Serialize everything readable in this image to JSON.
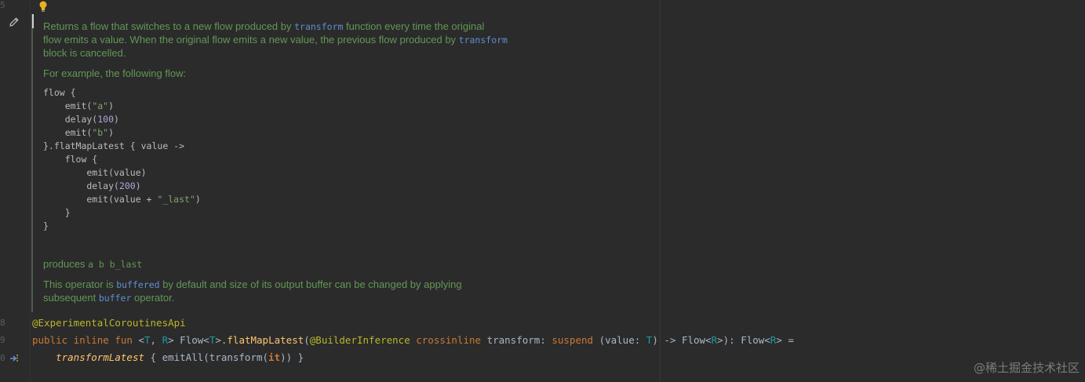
{
  "editor": {
    "gutter_numbers": [
      "5",
      "8",
      "9",
      "0"
    ],
    "doc": {
      "para1_line1_a": "Returns a flow that switches to a new flow produced by ",
      "para1_line1_code": "transform",
      "para1_line1_b": " function every time the original",
      "para1_line2_a": "flow emits a value. When the original flow emits a new value, the previous flow produced by ",
      "para1_line2_code": "transform",
      "para1_line3": "block is cancelled.",
      "para2": "For example, the following flow:",
      "code_lines": [
        "flow {",
        "    emit(\"a\")",
        "    delay(100)",
        "    emit(\"b\")",
        "}.flatMapLatest { value ->",
        "    flow {",
        "        emit(value)",
        "        delay(200)",
        "        emit(value + \"_last\")",
        "    }",
        "}"
      ],
      "produces_label": "produces ",
      "produces_code": "a b b_last",
      "para4_line1_a": "This operator is ",
      "para4_line1_code": "buffered",
      "para4_line1_b": " by default and size of its output buffer can be changed by applying",
      "para4_line2_a": "subsequent ",
      "para4_line2_code": "buffer",
      "para4_line2_b": " operator."
    },
    "code": {
      "line1": "@ExperimentalCoroutinesApi",
      "line2": {
        "t1": "public inline fun ",
        "t2": "<",
        "t3": "T",
        "t4": ", ",
        "t5": "R",
        "t6": "> Flow<",
        "t7": "T",
        "t8": ">.",
        "t9": "flatMapLatest",
        "t10": "(",
        "t11": "@BuilderInference ",
        "t12": "crossinline ",
        "t13": "transform: ",
        "t14": "suspend ",
        "t15": "(value: ",
        "t16": "T",
        "t17": ") -> Flow<",
        "t18": "R",
        "t19": ">): Flow<",
        "t20": "R",
        "t21": "> ="
      },
      "line3": {
        "t1": "    ",
        "t2": "transformLatest",
        "t3": " { emitAll(transform(",
        "t4": "it",
        "t5": ")) }"
      }
    },
    "watermark": "@稀土掘金技术社区",
    "colors": {
      "background": "#2b2b2b",
      "doc_text": "#629755",
      "keyword": "#cc7832",
      "annotation": "#bbb529",
      "type_param": "#20999d",
      "function": "#ffc66d"
    },
    "icons": [
      "pencil-icon",
      "lightbulb-icon",
      "implementation-icon"
    ]
  }
}
